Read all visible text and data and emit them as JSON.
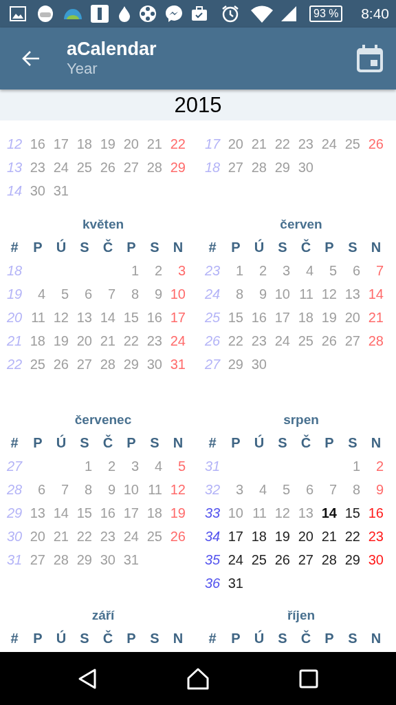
{
  "status_bar": {
    "battery": "93 %",
    "time": "8:40"
  },
  "app_bar": {
    "title": "aCalendar",
    "subtitle": "Year"
  },
  "year": "2015",
  "months": [
    {
      "weeks": [
        {
          "number": "12",
          "past": true,
          "days": [
            "16",
            "17",
            "18",
            "19",
            "20",
            "21",
            "22"
          ]
        },
        {
          "number": "13",
          "past": true,
          "days": [
            "23",
            "24",
            "25",
            "26",
            "27",
            "28",
            "29"
          ]
        },
        {
          "number": "14",
          "past": true,
          "days": [
            "30",
            "31"
          ]
        }
      ]
    },
    {
      "weeks": [
        {
          "number": "17",
          "past": true,
          "days": [
            "20",
            "21",
            "22",
            "23",
            "24",
            "25",
            "26"
          ]
        },
        {
          "number": "18",
          "past": true,
          "days": [
            "27",
            "28",
            "29",
            "30"
          ]
        }
      ]
    },
    {
      "name": "květen",
      "weekdays": [
        "#",
        "P",
        "Ú",
        "S",
        "Č",
        "P",
        "S",
        "N"
      ],
      "weeks": [
        {
          "number": "18",
          "past": true,
          "kind": "first",
          "days": [
            "1",
            "2",
            "3"
          ]
        },
        {
          "number": "19",
          "past": true,
          "days": [
            "4",
            "5",
            "6",
            "7",
            "8",
            "9",
            "10"
          ]
        },
        {
          "number": "20",
          "past": true,
          "days": [
            "11",
            "12",
            "13",
            "14",
            "15",
            "16",
            "17"
          ]
        },
        {
          "number": "21",
          "past": true,
          "days": [
            "18",
            "19",
            "20",
            "21",
            "22",
            "23",
            "24"
          ]
        },
        {
          "number": "22",
          "past": true,
          "days": [
            "25",
            "26",
            "27",
            "28",
            "29",
            "30",
            "31"
          ]
        }
      ]
    },
    {
      "name": "červen",
      "weekdays": [
        "#",
        "P",
        "Ú",
        "S",
        "Č",
        "P",
        "S",
        "N"
      ],
      "weeks": [
        {
          "number": "23",
          "past": true,
          "days": [
            "1",
            "2",
            "3",
            "4",
            "5",
            "6",
            "7"
          ]
        },
        {
          "number": "24",
          "past": true,
          "days": [
            "8",
            "9",
            "10",
            "11",
            "12",
            "13",
            "14"
          ]
        },
        {
          "number": "25",
          "past": true,
          "days": [
            "15",
            "16",
            "17",
            "18",
            "19",
            "20",
            "21"
          ]
        },
        {
          "number": "26",
          "past": true,
          "days": [
            "22",
            "23",
            "24",
            "25",
            "26",
            "27",
            "28"
          ]
        },
        {
          "number": "27",
          "past": true,
          "days": [
            "29",
            "30"
          ]
        }
      ]
    },
    {
      "name": "červenec",
      "weekdays": [
        "#",
        "P",
        "Ú",
        "S",
        "Č",
        "P",
        "S",
        "N"
      ],
      "weeks": [
        {
          "number": "27",
          "past": true,
          "kind": "first",
          "days": [
            "1",
            "2",
            "3",
            "4",
            "5"
          ]
        },
        {
          "number": "28",
          "past": true,
          "days": [
            "6",
            "7",
            "8",
            "9",
            "10",
            "11",
            "12"
          ]
        },
        {
          "number": "29",
          "past": true,
          "days": [
            "13",
            "14",
            "15",
            "16",
            "17",
            "18",
            "19"
          ]
        },
        {
          "number": "30",
          "past": true,
          "days": [
            "20",
            "21",
            "22",
            "23",
            "24",
            "25",
            "26"
          ]
        },
        {
          "number": "31",
          "past": true,
          "days": [
            "27",
            "28",
            "29",
            "30",
            "31"
          ]
        }
      ]
    },
    {
      "name": "srpen",
      "weekdays": [
        "#",
        "P",
        "Ú",
        "S",
        "Č",
        "P",
        "S",
        "N"
      ],
      "weeks": [
        {
          "number": "31",
          "past": true,
          "kind": "first",
          "days": [
            "1",
            "2"
          ]
        },
        {
          "number": "32",
          "past": true,
          "days": [
            "3",
            "4",
            "5",
            "6",
            "7",
            "8",
            "9"
          ]
        },
        {
          "number": "33",
          "past": false,
          "days": [
            {
              "text": "10",
              "past": true,
              "today": false
            },
            {
              "text": "11",
              "past": true,
              "today": false
            },
            {
              "text": "12",
              "past": true,
              "today": false
            },
            {
              "text": "13",
              "past": true,
              "today": false
            },
            {
              "text": "14",
              "past": false,
              "today": true
            },
            {
              "text": "15",
              "past": false,
              "today": false
            },
            {
              "text": "16",
              "past": false,
              "today": false
            }
          ]
        },
        {
          "number": "34",
          "past": false,
          "days": [
            "17",
            "18",
            "19",
            "20",
            "21",
            "22",
            "23"
          ]
        },
        {
          "number": "35",
          "past": false,
          "days": [
            "24",
            "25",
            "26",
            "27",
            "28",
            "29",
            "30"
          ]
        },
        {
          "number": "36",
          "past": false,
          "days": [
            "31"
          ]
        }
      ]
    },
    {
      "name": "září",
      "weekdays": [
        "#",
        "P",
        "Ú",
        "S",
        "Č",
        "P",
        "S",
        "N"
      ]
    },
    {
      "name": "říjen",
      "weekdays": [
        "#",
        "P",
        "Ú",
        "S",
        "Č",
        "P",
        "S",
        "N"
      ]
    }
  ]
}
